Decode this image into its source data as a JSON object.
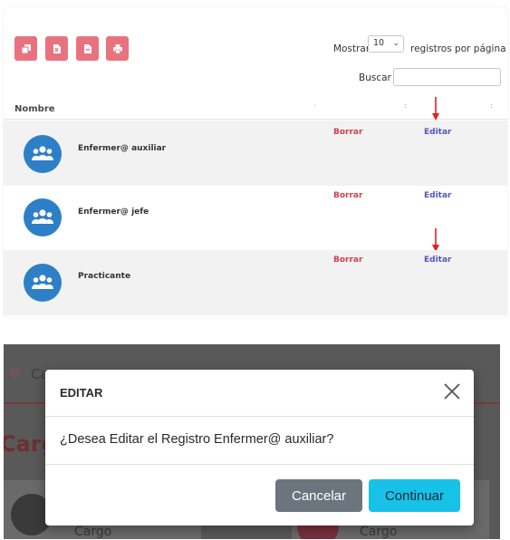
{
  "colors": {
    "export_button": "#e8737e",
    "borrar_link": "#d0404a",
    "editar_link": "#5555c0",
    "avatar": "#2d7fc8",
    "annotation_arrow": "#e02020",
    "cancel_button": "#6c757d",
    "continue_button": "#17c1e8"
  },
  "toolbar": {
    "buttons": [
      {
        "icon": "copy-icon"
      },
      {
        "icon": "excel-file-icon"
      },
      {
        "icon": "pdf-file-icon"
      },
      {
        "icon": "print-icon"
      }
    ]
  },
  "length_menu": {
    "prefix": "Mostrar",
    "value": "10",
    "suffix": "registros por página"
  },
  "search": {
    "label": "Buscar",
    "value": ""
  },
  "table": {
    "column_header": "Nombre",
    "rows": [
      {
        "name": "Enfermer@ auxiliar",
        "delete_label": "Borrar",
        "edit_label": "Editar"
      },
      {
        "name": "Enfermer@ jefe",
        "delete_label": "Borrar",
        "edit_label": "Editar"
      },
      {
        "name": "Practicante",
        "delete_label": "Borrar",
        "edit_label": "Editar"
      }
    ]
  },
  "background_page": {
    "crumb_partial": "Ca",
    "title_partial": "Carg",
    "card_labels": [
      "Cargo",
      "Cargo"
    ]
  },
  "modal": {
    "title": "EDITAR",
    "message": "¿Desea Editar el Registro Enfermer@ auxiliar?",
    "cancel_label": "Cancelar",
    "continue_label": "Continuar"
  }
}
